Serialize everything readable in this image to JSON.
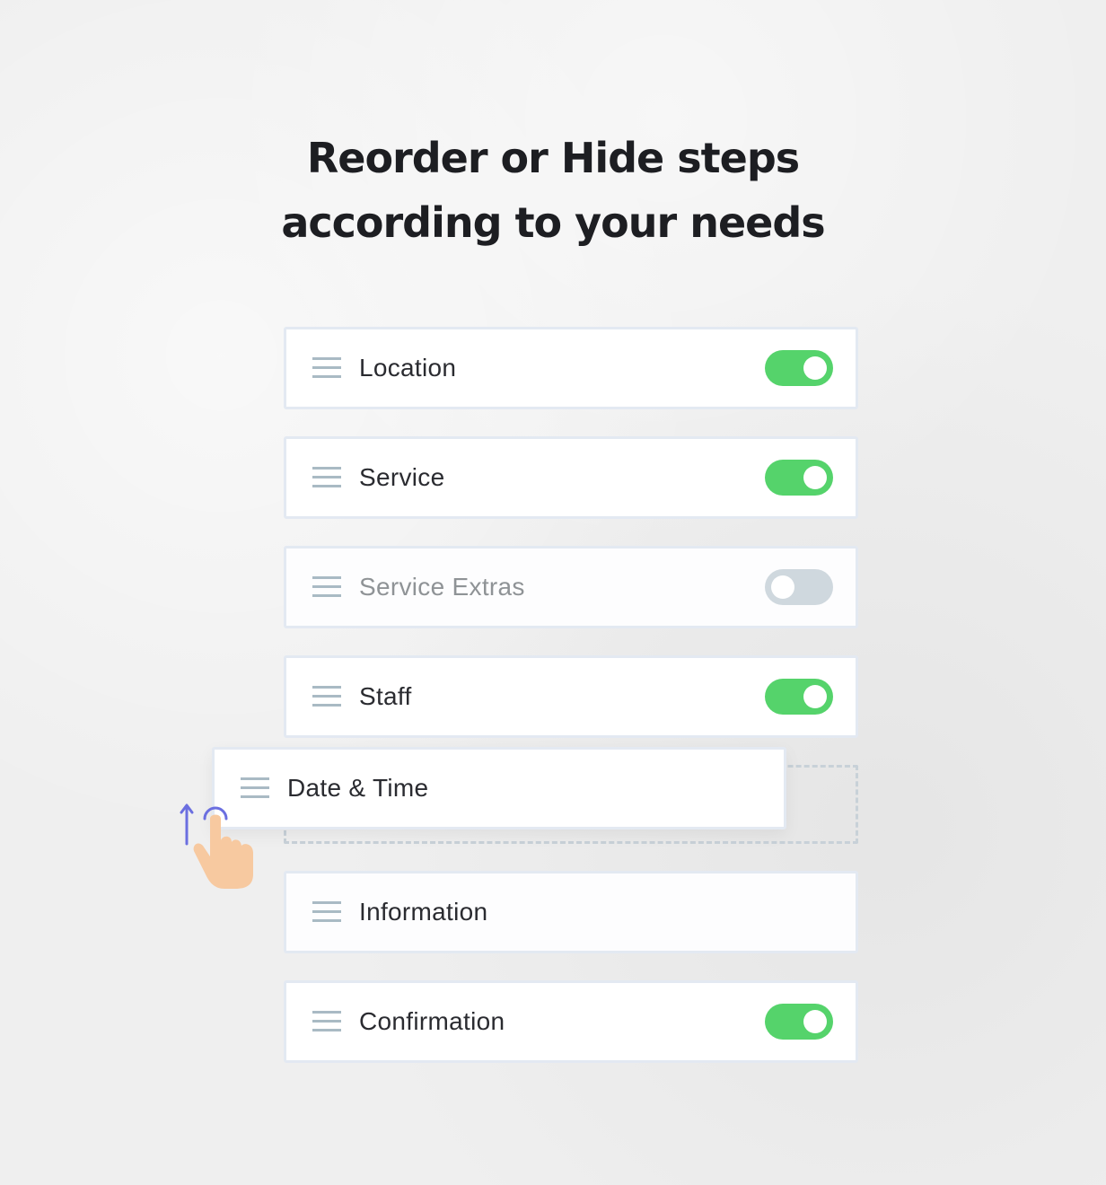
{
  "heading": {
    "line1": "Reorder or Hide steps",
    "line2": "according to your needs"
  },
  "colors": {
    "toggle_on": "#55d36b",
    "toggle_off": "#cfd8de",
    "gesture_arrow": "#6b6fe0",
    "hand": "#f7c9a0"
  },
  "steps": [
    {
      "label": "Location",
      "enabled": true,
      "has_toggle": true
    },
    {
      "label": "Service",
      "enabled": true,
      "has_toggle": true
    },
    {
      "label": "Service Extras",
      "enabled": false,
      "has_toggle": true
    },
    {
      "label": "Staff",
      "enabled": true,
      "has_toggle": true
    },
    {
      "label": "Date & Time",
      "enabled": true,
      "has_toggle": false,
      "state": "dragging"
    },
    {
      "label": "Information",
      "enabled": true,
      "has_toggle": false
    },
    {
      "label": "Confirmation",
      "enabled": true,
      "has_toggle": true
    }
  ],
  "icons": {
    "drag_handle": "drag-handle-icon",
    "gesture": "drag-up-gesture-icon"
  }
}
